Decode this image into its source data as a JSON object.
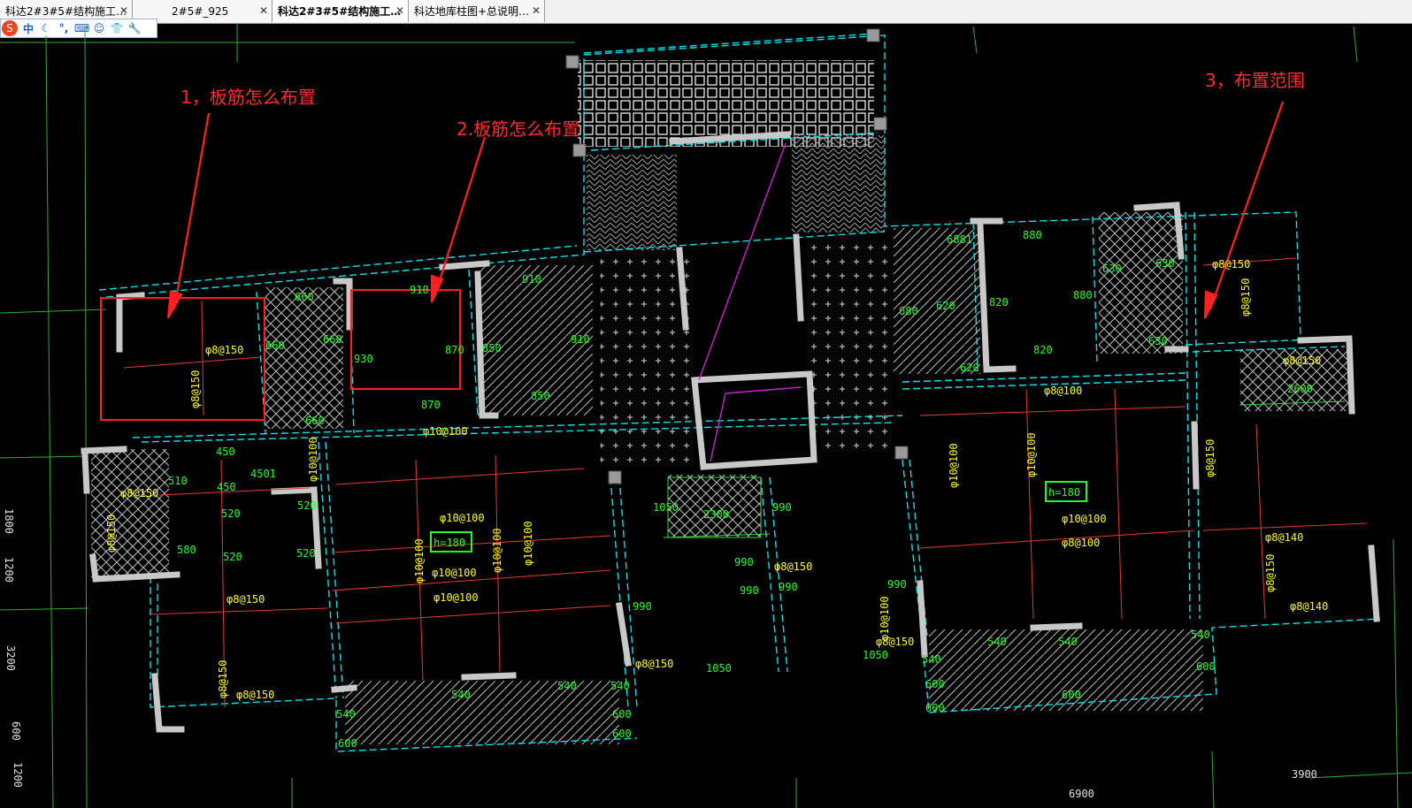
{
  "tabs": [
    {
      "label": "科达2#3#5#结构施工…",
      "active": false
    },
    {
      "label": "2#5#_925",
      "active": false
    },
    {
      "label": "科达2#3#5#结构施工…",
      "active": true
    },
    {
      "label": "科达地库柱图+总说明…",
      "active": false
    }
  ],
  "tab_close": "✕",
  "ime": {
    "logo": "S",
    "items": [
      "中",
      "☾",
      "°,",
      "⌨",
      "☺",
      "👕",
      "🔧"
    ]
  },
  "annotations": {
    "a1": "1，板筋怎么布置",
    "a2": "2.板筋怎么布置",
    "a3": "3，布置范围"
  },
  "colors": {
    "annotation": "#ff2b2b",
    "rebar_text": "#ffff00",
    "dim_text": "#00ff00",
    "cyan": "#00e5ee",
    "background": "#000000"
  },
  "rebar_labels": [
    "φ8@150",
    "φ8@150",
    "φ10@100",
    "φ10@100",
    "φ10@100",
    "φ10@100",
    "φ10@100",
    "φ10@100",
    "φ8@150",
    "φ8@150",
    "φ8@150",
    "φ8@150",
    "φ8@150",
    "φ8@150",
    "φ10@100",
    "φ10@100",
    "φ8@100",
    "φ10@100",
    "φ10@100",
    "φ10@100",
    "φ8@100",
    "φ8@150",
    "φ8@150",
    "φ8@140",
    "φ8@150",
    "φ8@140",
    "φ8@150",
    "φ8@150",
    "φ8@150",
    "φ10@100",
    "φ8@150"
  ],
  "dim_labels": [
    "660",
    "660",
    "660",
    "660",
    "930",
    "910",
    "870",
    "850",
    "910",
    "850",
    "910",
    "870",
    "450",
    "450",
    "510",
    "520",
    "520",
    "520",
    "580",
    "520",
    "4501",
    "990",
    "990",
    "990",
    "990",
    "990",
    "2300",
    "1050",
    "1050",
    "1050",
    "540",
    "540",
    "540",
    "600",
    "600",
    "600",
    "540",
    "540",
    "600",
    "680",
    "620",
    "820",
    "820",
    "620",
    "880",
    "880",
    "630",
    "630",
    "630",
    "540",
    "540",
    "600",
    "600",
    "600",
    "540",
    "990",
    "2600",
    "h=180",
    "h=180",
    "6881"
  ],
  "side_dims": [
    "1800",
    "1200",
    "3200",
    "600",
    "1200"
  ],
  "bottom_dims": [
    "6900",
    "3900"
  ]
}
